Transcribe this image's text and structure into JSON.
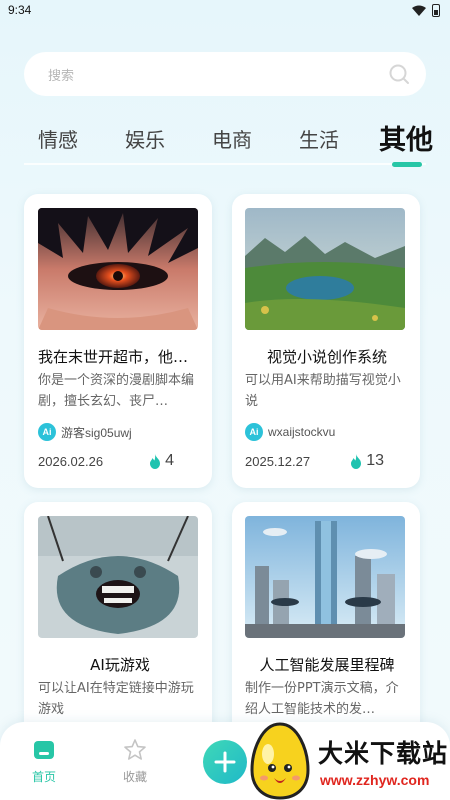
{
  "status_bar": {
    "time": "9:34"
  },
  "search": {
    "placeholder": "搜索"
  },
  "tabs": [
    {
      "label": "情感",
      "active": false
    },
    {
      "label": "娱乐",
      "active": false
    },
    {
      "label": "电商",
      "active": false
    },
    {
      "label": "生活",
      "active": false
    },
    {
      "label": "其他",
      "active": true
    }
  ],
  "cards": [
    {
      "title": "我在末世开超市，他…",
      "description": "你是一个资深的漫剧脚本编剧，擅长玄幻、丧尸…",
      "author": "游客sig05uwj",
      "date": "2026.02.26",
      "heat": "4",
      "image": "anime-eye-image"
    },
    {
      "title": "视觉小说创作系统",
      "description": "可以用AI来帮助描写视觉小说",
      "author": "wxaijstockvu",
      "date": "2025.12.27",
      "heat": "13",
      "image": "landscape-lake-image"
    },
    {
      "title": "AI玩游戏",
      "description": "可以让AI在特定链接中游玩游戏",
      "image": "funny-creature-image"
    },
    {
      "title": "人工智能发展里程碑",
      "description": "制作一份PPT演示文稿，介绍人工智能技术的发…",
      "image": "futuristic-city-image"
    }
  ],
  "author_avatar_text": "Ai",
  "bottom_nav": {
    "home": "首页",
    "favorites": "收藏"
  },
  "watermark": {
    "title": "大米下载站",
    "url": "www.zzhyw.com"
  },
  "colors": {
    "accent": "#27c6a6",
    "background": "#e6f6fb",
    "watermark_url": "#e0261f"
  }
}
